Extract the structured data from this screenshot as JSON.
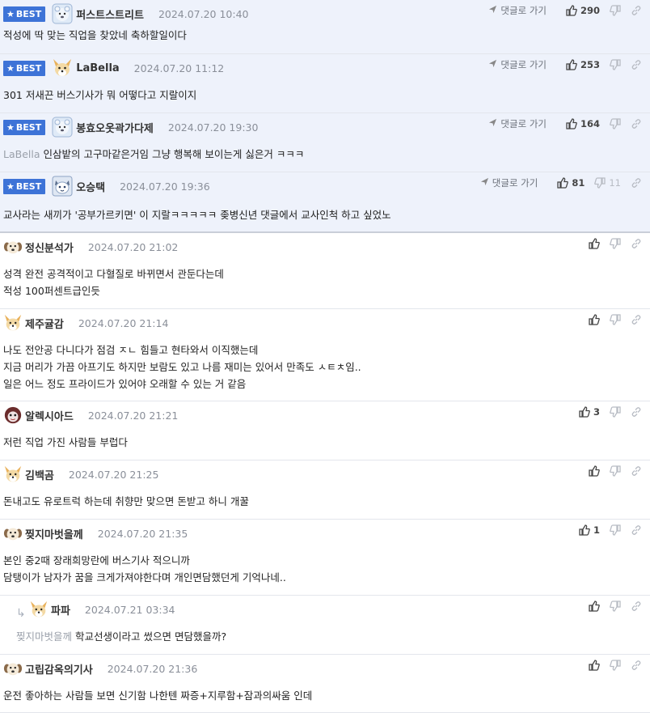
{
  "goto_label": "댓글로 가기",
  "best_label": "BEST",
  "colors": {
    "best_badge": "#3d73d7",
    "best_bg": "#eef2fb",
    "meta": "#8a8f99"
  },
  "comments": [
    {
      "best": true,
      "nick": "퍼스트스트리트",
      "date": "2024.07.20 10:40",
      "avatar": "bear",
      "goto": true,
      "likes": "290",
      "dislikes": "",
      "lines": [
        "적성에 딱 맞는 직업을 찾았네 축하할일이다"
      ]
    },
    {
      "best": true,
      "nick": "LaBella",
      "date": "2024.07.20 11:12",
      "avatar": "fox",
      "goto": true,
      "likes": "253",
      "dislikes": "",
      "lines": [
        "301 저새끈 버스기사가 뭐 어떻다고 지랄이지"
      ]
    },
    {
      "best": true,
      "nick": "봉효오옷곽가다제",
      "date": "2024.07.20 19:30",
      "avatar": "bear",
      "goto": true,
      "likes": "164",
      "dislikes": "",
      "mention": "LaBella",
      "lines": [
        "인삼밭의 고구마같은거임 그냥 행복해 보이는게 싫은거 ㅋㅋㅋ"
      ]
    },
    {
      "best": true,
      "nick": "오승택",
      "date": "2024.07.20 19:36",
      "avatar": "cat",
      "goto": true,
      "likes": "81",
      "dislikes": "11",
      "lines": [
        "교사라는 새끼가 '공부가르키면' 이 지랄ㅋㅋㅋㅋㅋ 좆병신년 댓글에서 교사인척 하고 싶었노"
      ]
    },
    {
      "best": false,
      "nick": "정신분석가",
      "date": "2024.07.20 21:02",
      "avatar": "dog",
      "likes": "",
      "dislikes": "",
      "lines": [
        "성격 완전 공격적이고 다혈질로 바뀌면서 관둔다는데",
        "적성 100퍼센트급인듯"
      ]
    },
    {
      "best": false,
      "nick": "제주귤감",
      "date": "2024.07.20 21:14",
      "avatar": "fox",
      "likes": "",
      "dislikes": "",
      "lines": [
        "나도 전안공 다니다가 점검 ㅈㄴ 힘들고 현타와서 이직했는데",
        "지금 머리가 가끔 아프기도 하지만 보람도 있고 나름 재미는 있어서 만족도 ㅅㅌㅊ임..",
        "일은 어느 정도 프라이드가 있어야 오래할 수 있는 거 같음"
      ]
    },
    {
      "best": false,
      "nick": "알렉시아드",
      "date": "2024.07.20 21:21",
      "avatar": "monkey",
      "likes": "3",
      "dislikes": "",
      "lines": [
        "저런 직업 가진 사람들 부럽다"
      ]
    },
    {
      "best": false,
      "nick": "김백곰",
      "date": "2024.07.20 21:25",
      "avatar": "fox",
      "likes": "",
      "dislikes": "",
      "lines": [
        "돈내고도 유로트럭 하는데 취향만 맞으면 돈받고 하니 개꿀"
      ]
    },
    {
      "best": false,
      "nick": "찢지마벗을께",
      "date": "2024.07.20 21:35",
      "avatar": "dog",
      "likes": "1",
      "dislikes": "",
      "lines": [
        "본인 중2때 장래희망란에 버스기사 적으니까",
        "담탱이가 남자가 꿈을 크게가져야한다며 개인면담했던게 기억나네.."
      ]
    },
    {
      "best": false,
      "reply": true,
      "nick": "파파",
      "date": "2024.07.21 03:34",
      "avatar": "fox",
      "likes": "",
      "dislikes": "",
      "mention": "찢지마벗을께",
      "lines": [
        "학교선생이라고 썼으면 면담했을까?"
      ]
    },
    {
      "best": false,
      "nick": "고립감옥의기사",
      "date": "2024.07.20 21:36",
      "avatar": "dog",
      "likes": "",
      "dislikes": "",
      "lines": [
        "운전 좋아하는 사람들 보면 신기함 나한텐 짜증+지루함+잠과의싸움 인데"
      ]
    }
  ]
}
